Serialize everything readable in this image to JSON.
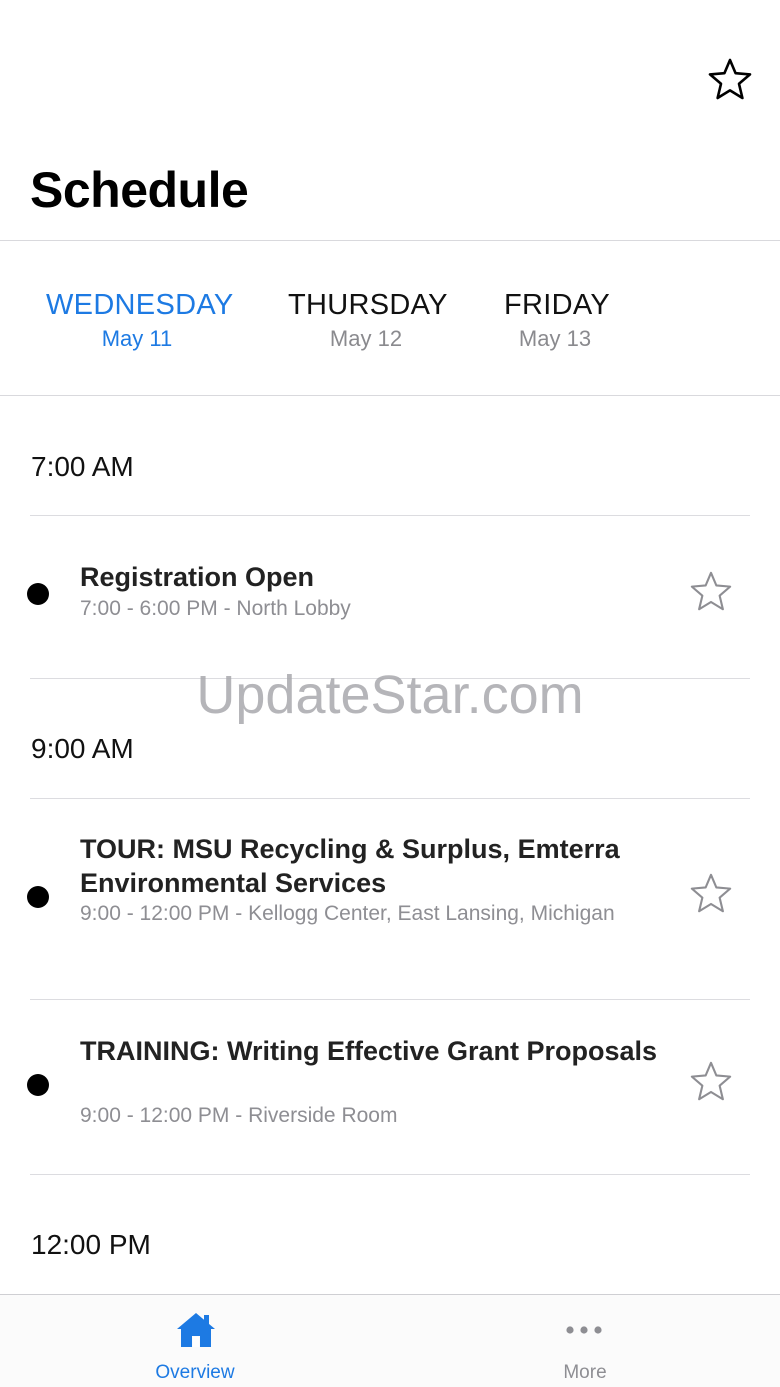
{
  "header": {
    "title": "Schedule",
    "favorites_icon": "star-outline-icon"
  },
  "days": [
    {
      "name": "WEDNESDAY",
      "date": "May 11",
      "active": true
    },
    {
      "name": "THURSDAY",
      "date": "May 12",
      "active": false
    },
    {
      "name": "FRIDAY",
      "date": "May 13",
      "active": false
    }
  ],
  "schedule": {
    "slots": [
      {
        "time": "7:00 AM"
      },
      {
        "time": "9:00 AM"
      },
      {
        "time": "12:00 PM"
      }
    ],
    "events": [
      {
        "title": "Registration Open",
        "subtitle": "7:00 - 6:00 PM - North Lobby",
        "favorite_icon": "star-outline-icon"
      },
      {
        "title": "TOUR: MSU Recycling & Surplus, Emterra Environmental Services",
        "subtitle": "9:00 - 12:00 PM - Kellogg Center, East Lansing, Michigan",
        "favorite_icon": "star-outline-icon"
      },
      {
        "title": "TRAINING: Writing Effective Grant Proposals",
        "subtitle": "9:00 - 12:00 PM - Riverside Room",
        "favorite_icon": "star-outline-icon"
      }
    ]
  },
  "watermark": "UpdateStar.com",
  "tabbar": {
    "items": [
      {
        "label": "Overview",
        "icon": "home-icon",
        "active": true
      },
      {
        "label": "More",
        "icon": "more-dots-icon",
        "active": false
      }
    ]
  },
  "colors": {
    "accent": "#1d7ae3",
    "secondary_text": "#8e8e93",
    "inactive_tab": "#8e8e93",
    "separator": "#dcdce0"
  }
}
